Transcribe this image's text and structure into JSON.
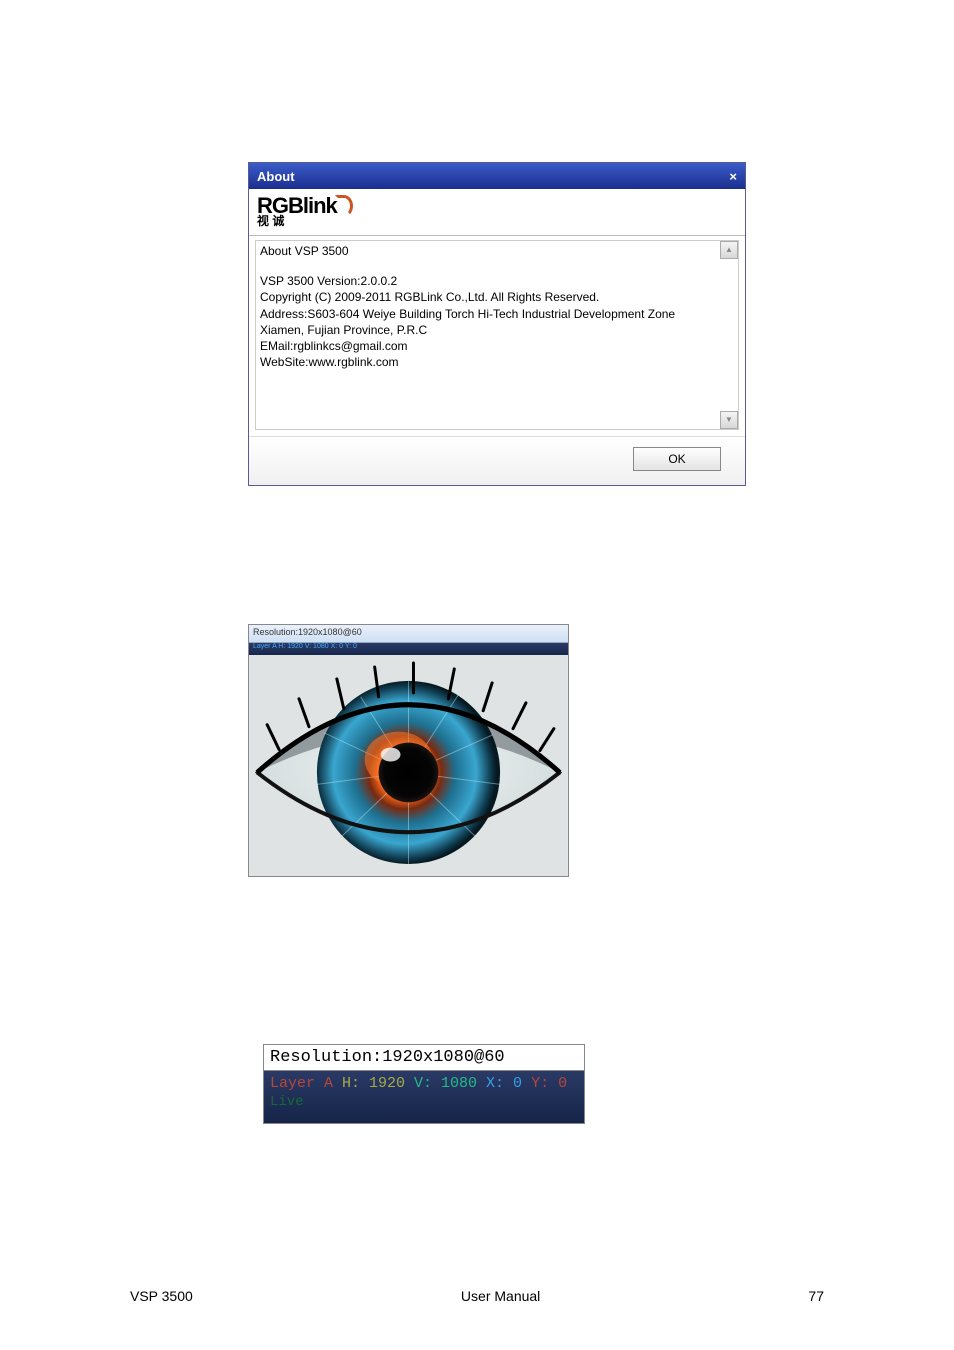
{
  "about": {
    "title": "About",
    "close_glyph": "×",
    "logo_text": "RGBlink",
    "logo_sub": "视 诚",
    "heading": "About VSP 3500",
    "lines": [
      "VSP 3500  Version:2.0.0.2",
      "Copyright (C) 2009-2011 RGBLink Co.,Ltd. All Rights Reserved.",
      "Address:S603-604 Weiye Building Torch Hi-Tech Industrial Development Zone",
      "Xiamen, Fujian Province, P.R.C",
      "EMail:rgblinkcs@gmail.com",
      "WebSite:www.rgblink.com"
    ],
    "ok_label": "OK",
    "scroll_up": "▲",
    "scroll_down": "▼"
  },
  "preview": {
    "title": "Resolution:1920x1080@60",
    "strip_text": "Layer A H: 1920 V: 1080 X: 0 Y: 0"
  },
  "res_detail": {
    "top": "Resolution:1920x1080@60",
    "layer_prefix": "Layer A ",
    "h_label": "H: 1920 ",
    "v_label": "V: 1080 ",
    "x_label": "X: 0 ",
    "y_label": "Y: 0",
    "line2": "Live"
  },
  "footer": {
    "left": "VSP 3500",
    "center": "User Manual",
    "right": "77"
  }
}
